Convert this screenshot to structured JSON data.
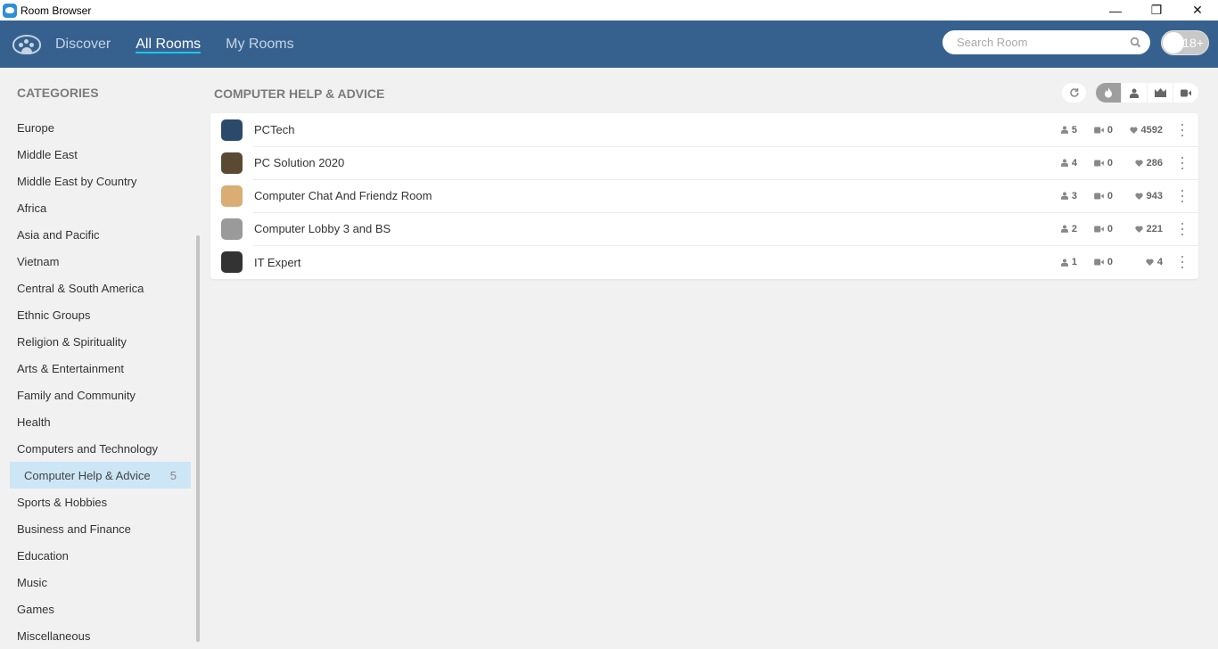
{
  "window": {
    "title": "Room Browser",
    "controls": {
      "minimize": "—",
      "restore": "❐",
      "close": "✕"
    }
  },
  "nav": {
    "tabs": [
      {
        "label": "Discover",
        "active": false
      },
      {
        "label": "All Rooms",
        "active": true
      },
      {
        "label": "My Rooms",
        "active": false
      }
    ],
    "search": {
      "placeholder": "Search Room",
      "value": ""
    },
    "adult_toggle": {
      "label": "18+",
      "on": false
    }
  },
  "sidebar": {
    "heading": "CATEGORIES",
    "items": [
      {
        "label": "Europe"
      },
      {
        "label": "Middle East"
      },
      {
        "label": "Middle East by Country"
      },
      {
        "label": "Africa"
      },
      {
        "label": "Asia and Pacific"
      },
      {
        "label": "Vietnam"
      },
      {
        "label": "Central & South America"
      },
      {
        "label": "Ethnic Groups"
      },
      {
        "label": "Religion & Spirituality"
      },
      {
        "label": "Arts & Entertainment"
      },
      {
        "label": "Family and Community"
      },
      {
        "label": "Health"
      },
      {
        "label": "Computers and Technology"
      },
      {
        "label": "Computer Help & Advice",
        "count": "5",
        "selected": true
      },
      {
        "label": "Sports & Hobbies"
      },
      {
        "label": "Business and Finance"
      },
      {
        "label": "Education"
      },
      {
        "label": "Music"
      },
      {
        "label": "Games"
      },
      {
        "label": "Miscellaneous"
      }
    ]
  },
  "main": {
    "title": "COMPUTER HELP & ADVICE",
    "sort_options": [
      "popular",
      "users",
      "premium",
      "cameras"
    ],
    "active_sort": "popular",
    "rooms": [
      {
        "name": "PCTech",
        "users": "5",
        "cams": "0",
        "likes": "4592",
        "avatar_color": "#2b4a6b"
      },
      {
        "name": "PC Solution 2020",
        "users": "4",
        "cams": "0",
        "likes": "286",
        "avatar_color": "#5a4a33"
      },
      {
        "name": "Computer Chat And Friendz Room",
        "users": "3",
        "cams": "0",
        "likes": "943",
        "avatar_color": "#d9ad74"
      },
      {
        "name": "Computer Lobby 3 and BS",
        "users": "2",
        "cams": "0",
        "likes": "221",
        "avatar_color": "#9a9a9a"
      },
      {
        "name": "IT Expert",
        "users": "1",
        "cams": "0",
        "likes": "4",
        "avatar_color": "#333333"
      }
    ]
  },
  "colors": {
    "navbar": "#36618f",
    "active_underline": "#19c7ec",
    "selected_category": "#cce6f5"
  }
}
